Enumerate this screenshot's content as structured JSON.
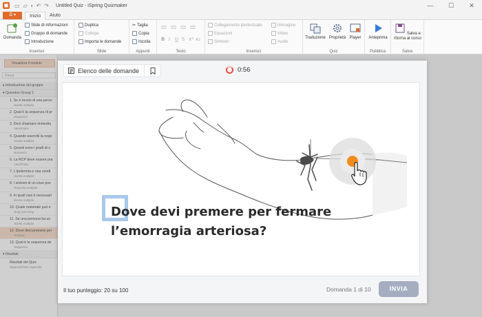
{
  "window": {
    "title": "Untitled Quiz - iSpring Quizmaker",
    "minimize": "—",
    "maximize": "☐",
    "close": "✕"
  },
  "tabs": {
    "file": "☰ ▾",
    "home": "Inizio",
    "help": "Aiuto"
  },
  "ribbon": {
    "insert_group": {
      "label": "Inserisci",
      "question": "Domanda",
      "info_slide": "Slide di informazioni",
      "question_group": "Gruppo di domande",
      "intro": "Introduzione"
    },
    "slide_group": {
      "label": "Slide",
      "duplicate": "Duplica",
      "link": "Collega",
      "import": "Importa le domande"
    },
    "notes_group": {
      "label": "Appunti",
      "cut": "Taglia",
      "copy": "Copia",
      "paste": "Incolla"
    },
    "text_group": {
      "label": "Testo"
    },
    "insert2_group": {
      "label": "Inserisci",
      "link": "Collegamento ipertestuale",
      "equations": "Equazioni",
      "symbol": "Simbolo",
      "image": "Immagine",
      "video": "Video",
      "audio": "Audio"
    },
    "quiz_group": {
      "label": "Quiz",
      "translate": "Traduzione",
      "properties": "Proprietà",
      "player": "Player"
    },
    "publish_group": {
      "label": "Pubblica",
      "preview": "Anteprima"
    },
    "save_group": {
      "label": "Salva",
      "save_return": "Salva e ritorna al corso"
    }
  },
  "left_panel": {
    "show_module": "Visualizza il modulo",
    "search": "Cerca",
    "intro_group": "Introduzione del gruppo",
    "question_group": "Question Group 1",
    "questions": [
      {
        "title": "1. Se è tonsio di una perso",
        "type": "Scelta multipla"
      },
      {
        "title": "2. Qual è la sequenza di pr",
        "type": "Sequenza"
      },
      {
        "title": "3. Devi chiamare immedia",
        "type": "Vero/Falso"
      },
      {
        "title": "4. Quando esercitii la respi",
        "type": "Scelta multipla"
      },
      {
        "title": "5. Quanti sono i gradi di u",
        "type": "Numerico"
      },
      {
        "title": "6. La RCP deve essere pra",
        "type": "Vero/Falso"
      },
      {
        "title": "7. L'ipotermia e una condi",
        "type": "Scelta multipla"
      },
      {
        "title": "8. I sintomi di un ictus pos",
        "type": "Risposta multipla"
      },
      {
        "title": "9. In quali casi è necessari",
        "type": "Scelta multipla"
      },
      {
        "title": "10. Quale materiale può e",
        "type": "Drag and Drop"
      },
      {
        "title": "11. Se una persona ha un",
        "type": "Scelta multipla"
      },
      {
        "title": "12. Dove devi premere per",
        "type": "Hotspot"
      },
      {
        "title": "13. Qual è la sequenza de",
        "type": "Sequenza"
      }
    ],
    "results_group": "Risultati",
    "results_title": "Risultati del Quiz",
    "results_sub": "Superato/Non superato"
  },
  "preview": {
    "question_list": "Elenco delle domande",
    "timer": "0:56",
    "question": "Dove devi premere per fermare l’emorragia arteriosa?",
    "score": "Il tuo punteggio: 20 su 100",
    "page": "Domanda 1 di 10",
    "submit": "INVIA"
  },
  "colors": {
    "accent": "#e06b2a",
    "hotspot": "#f08c1c",
    "timer": "#e84d3d",
    "submit": "#a5aec0",
    "selection": "#a9c8ec"
  }
}
